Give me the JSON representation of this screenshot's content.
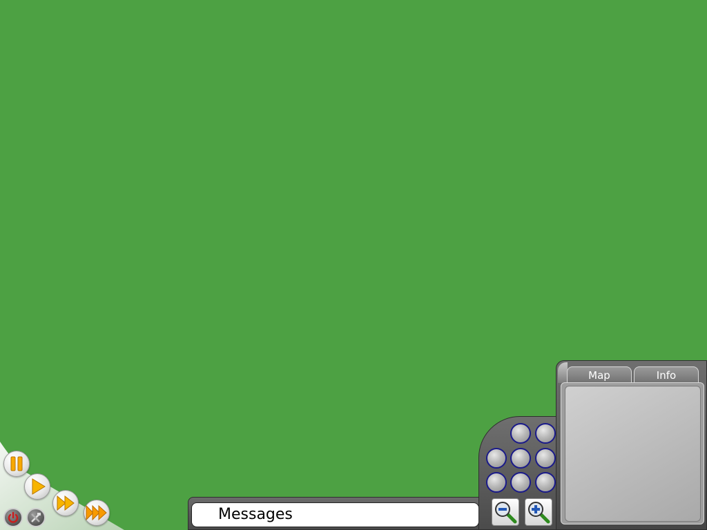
{
  "game": {
    "background_color": "#4da143"
  },
  "speed_controls": {
    "buttons": [
      {
        "name": "pause",
        "icon": "pause-icon"
      },
      {
        "name": "play",
        "icon": "play-icon"
      },
      {
        "name": "fast",
        "icon": "fast-forward-icon"
      },
      {
        "name": "fastest",
        "icon": "fastest-forward-icon"
      }
    ],
    "power_icon": "power-icon",
    "tools_icon": "tools-icon"
  },
  "message_bar": {
    "text": "Messages"
  },
  "navigation": {
    "zoom_out_icon": "zoom-out-icon",
    "zoom_in_icon": "zoom-in-icon"
  },
  "side_panel": {
    "tabs": [
      {
        "label": "Map"
      },
      {
        "label": "Info"
      }
    ]
  }
}
